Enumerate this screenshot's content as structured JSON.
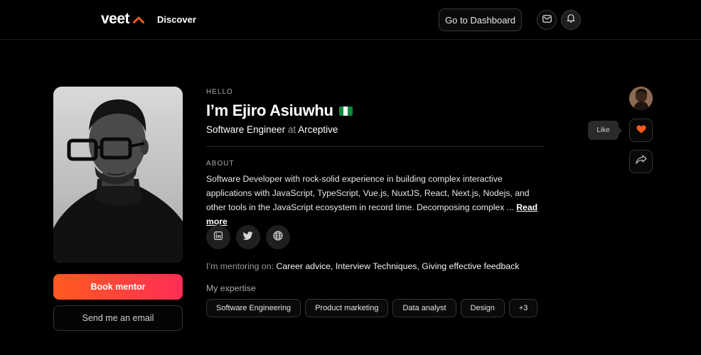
{
  "header": {
    "logo_text": "veet",
    "nav_discover": "Discover",
    "dashboard_button": "Go to Dashboard"
  },
  "profile": {
    "greeting": "HELLO",
    "name": "I’m Ejiro Asiuwhu",
    "role": "Software Engineer",
    "at": "at",
    "company": "Arceptive",
    "about_label": "ABOUT",
    "bio": "Software Developer with rock-solid experience in building complex interactive applications with JavaScript, TypeScript, Vue.js, NuxtJS, React, Next.js, Nodejs, and other tools in the JavaScript ecosystem in record time. Decomposing complex ...",
    "read_more": "Read more",
    "mentoring_label": "I’m mentoring on:",
    "mentoring_topics": "Career advice, Interview Techniques, Giving effective feedback",
    "expertise_label": "My expertise",
    "expertise": [
      "Software Engineering",
      "Product marketing",
      "Data analyst",
      "Design",
      "+3"
    ]
  },
  "actions": {
    "book_mentor": "Book mentor",
    "send_email": "Send me an email",
    "like_tooltip": "Like"
  },
  "icons": {
    "logo_mark": "chevron-up-icon",
    "mail": "mail-icon",
    "bell": "bell-icon",
    "linkedin": "linkedin-icon",
    "twitter": "twitter-icon",
    "web": "globe-icon",
    "like": "heart-icon",
    "share": "share-icon"
  },
  "colors": {
    "accent": "#ff5a1f",
    "accent_gradient_end": "#ff2d55",
    "background": "#000000"
  }
}
